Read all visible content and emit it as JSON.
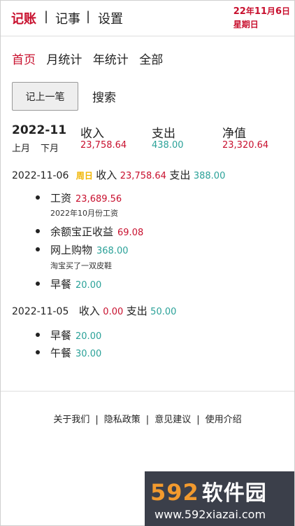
{
  "header": {
    "brand": "记账",
    "sep": "|",
    "nav": [
      "记事",
      "设置"
    ],
    "date": {
      "yy": "22",
      "year_unit": "年",
      "month": "11",
      "month_unit": "月",
      "day": "6",
      "day_unit": "日",
      "weekday": "星期日"
    }
  },
  "tabs": [
    {
      "label": "首页",
      "active": true
    },
    {
      "label": "月统计",
      "active": false
    },
    {
      "label": "年统计",
      "active": false
    },
    {
      "label": "全部",
      "active": false
    }
  ],
  "actions": {
    "record": "记上一笔",
    "search": "搜索"
  },
  "summary": {
    "month": "2022-11",
    "prev": "上月",
    "next": "下月",
    "income_label": "收入",
    "income": "23,758.64",
    "expense_label": "支出",
    "expense": "438.00",
    "net_label": "净值",
    "net": "23,320.64"
  },
  "days": [
    {
      "date": "2022-11-06",
      "weekend": "周日",
      "income_label": "收入",
      "income": "23,758.64",
      "expense_label": "支出",
      "expense": "388.00",
      "entries": [
        {
          "name": "工资",
          "amount": "23,689.56",
          "type": "income",
          "note": "2022年10月份工资"
        },
        {
          "name": "余额宝正收益",
          "amount": "69.08",
          "type": "income",
          "note": ""
        },
        {
          "name": "网上购物",
          "amount": "368.00",
          "type": "expense",
          "note": "淘宝买了一双皮鞋"
        },
        {
          "name": "早餐",
          "amount": "20.00",
          "type": "expense",
          "note": ""
        }
      ]
    },
    {
      "date": "2022-11-05",
      "weekend": "",
      "income_label": "收入",
      "income": "0.00",
      "expense_label": "支出",
      "expense": "50.00",
      "entries": [
        {
          "name": "早餐",
          "amount": "20.00",
          "type": "expense",
          "note": ""
        },
        {
          "name": "午餐",
          "amount": "30.00",
          "type": "expense",
          "note": ""
        }
      ]
    }
  ],
  "footer": {
    "links": [
      "关于我们",
      "隐私政策",
      "意见建议",
      "使用介绍"
    ],
    "sep": "|"
  },
  "watermark": {
    "logo_num": "592",
    "logo_text": "软件园",
    "url": "www.592xiazai.com"
  },
  "colors": {
    "accent_red": "#c8102e",
    "income_red": "#c8102e",
    "expense_green": "#2aa198",
    "weekend_yellow": "#f0b400"
  }
}
